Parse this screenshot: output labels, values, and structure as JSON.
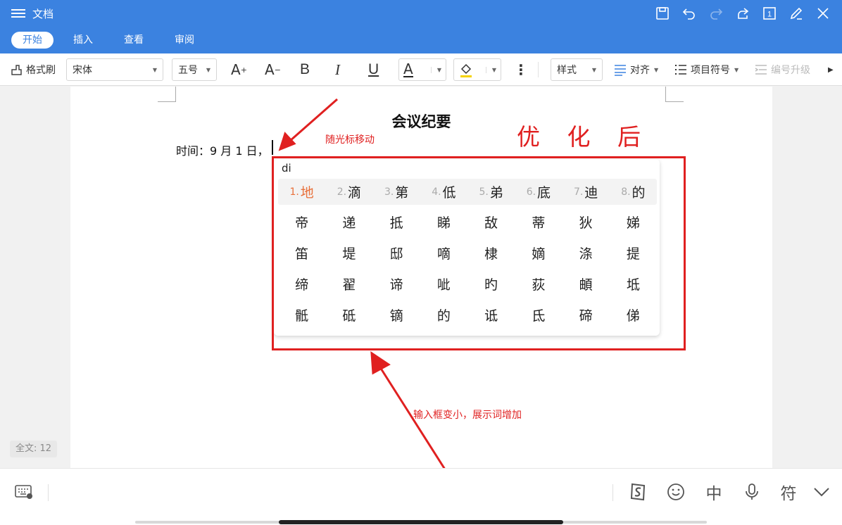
{
  "titlebar": {
    "title": "文档",
    "icons": [
      "menu-icon",
      "save-icon",
      "undo-icon",
      "redo-icon",
      "share-icon",
      "page-count-icon",
      "edit-pen-icon",
      "close-icon"
    ],
    "page_count": "1"
  },
  "tabs": [
    {
      "label": "开始",
      "active": true
    },
    {
      "label": "插入",
      "active": false
    },
    {
      "label": "查看",
      "active": false
    },
    {
      "label": "审阅",
      "active": false
    }
  ],
  "toolbar": {
    "format_painter": "格式刷",
    "font_name": "宋体",
    "font_size": "五号",
    "grow_font": "A",
    "shrink_font": "A",
    "bold": "B",
    "italic": "I",
    "underline": "U",
    "font_color": "A",
    "style": "样式",
    "align": "对齐",
    "bullets": "项目符号",
    "promote": "编号升级"
  },
  "document": {
    "title": "会议纪要",
    "line1": "时间：9 月 1 日，"
  },
  "word_count": "全文: 12",
  "annotations": {
    "cursor_note": "随光标移动",
    "optimized": "优 化 后",
    "bottom_note": "输入框变小，展示词增加"
  },
  "ime": {
    "input": "di",
    "top_candidates": [
      {
        "num": "1.",
        "char": "地"
      },
      {
        "num": "2.",
        "char": "滴"
      },
      {
        "num": "3.",
        "char": "第"
      },
      {
        "num": "4.",
        "char": "低"
      },
      {
        "num": "5.",
        "char": "弟"
      },
      {
        "num": "6.",
        "char": "底"
      },
      {
        "num": "7.",
        "char": "迪"
      },
      {
        "num": "8.",
        "char": "的"
      }
    ],
    "grid": [
      [
        "帝",
        "递",
        "抵",
        "睇",
        "敌",
        "蒂",
        "狄",
        "娣"
      ],
      [
        "笛",
        "堤",
        "邸",
        "嘀",
        "棣",
        "嫡",
        "涤",
        "提"
      ],
      [
        "缔",
        "翟",
        "谛",
        "呲",
        "旳",
        "荻",
        "頔",
        "坻"
      ],
      [
        "骶",
        "砥",
        "镝",
        "的",
        "诋",
        "氐",
        "碲",
        "俤"
      ]
    ]
  },
  "keyboard": {
    "ime_chinese": "中",
    "symbols": "符"
  },
  "colors": {
    "brand_blue": "#3b82e0",
    "annotation_red": "#e02020",
    "highlight_orange": "#e8703a",
    "highlight_yellow": "#f5d300"
  }
}
